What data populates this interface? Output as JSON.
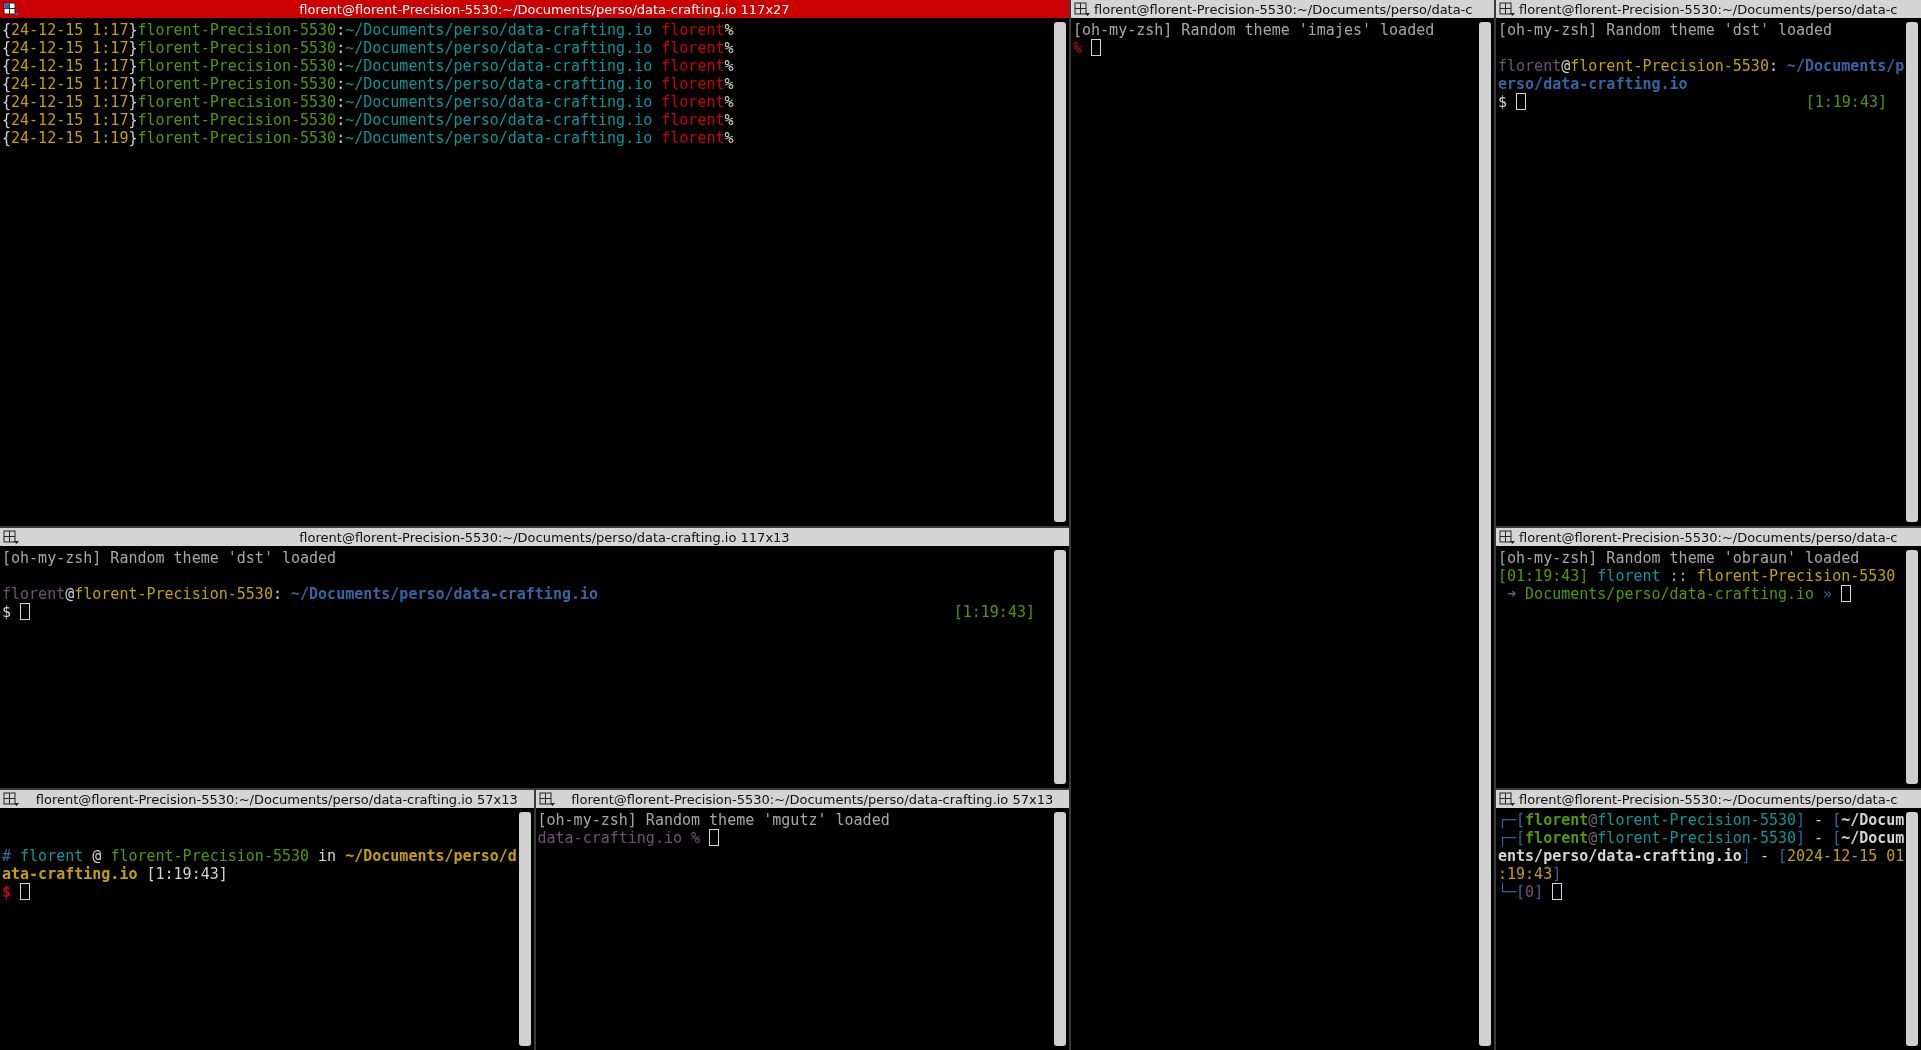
{
  "columns": [
    {
      "rows": [
        {
          "panes": [
            {
              "title": "florent@florent-Precision-5530:~/Documents/perso/data-crafting.io 117x27",
              "active": true,
              "lines": [
                {
                  "kind": "text",
                  "segments": [
                    {
                      "text": "{",
                      "color": "#d3d7cf",
                      "kind": "text"
                    },
                    {
                      "text": "24-12-15 1:17",
                      "color": "#c4a000",
                      "kind": "text"
                    },
                    {
                      "text": "}",
                      "color": "#d3d7cf",
                      "kind": "text"
                    },
                    {
                      "text": "florent-Precision-5530",
                      "color": "#4e9a06",
                      "kind": "text"
                    },
                    {
                      "text": ":",
                      "color": "#d3d7cf",
                      "kind": "text"
                    },
                    {
                      "text": "~/Documents/perso/data-crafting.io ",
                      "color": "#06989a",
                      "kind": "text"
                    },
                    {
                      "text": "florent",
                      "color": "#cc0000",
                      "kind": "text"
                    },
                    {
                      "text": "%",
                      "color": "#d3d7cf",
                      "kind": "text"
                    }
                  ]
                },
                {
                  "kind": "text",
                  "segments": [
                    {
                      "text": "{",
                      "color": "#d3d7cf",
                      "kind": "text"
                    },
                    {
                      "text": "24-12-15 1:17",
                      "color": "#c4a000",
                      "kind": "text"
                    },
                    {
                      "text": "}",
                      "color": "#d3d7cf",
                      "kind": "text"
                    },
                    {
                      "text": "florent-Precision-5530",
                      "color": "#4e9a06",
                      "kind": "text"
                    },
                    {
                      "text": ":",
                      "color": "#d3d7cf",
                      "kind": "text"
                    },
                    {
                      "text": "~/Documents/perso/data-crafting.io ",
                      "color": "#06989a",
                      "kind": "text"
                    },
                    {
                      "text": "florent",
                      "color": "#cc0000",
                      "kind": "text"
                    },
                    {
                      "text": "%",
                      "color": "#d3d7cf",
                      "kind": "text"
                    }
                  ]
                },
                {
                  "kind": "text",
                  "segments": [
                    {
                      "text": "{",
                      "color": "#d3d7cf",
                      "kind": "text"
                    },
                    {
                      "text": "24-12-15 1:17",
                      "color": "#c4a000",
                      "kind": "text"
                    },
                    {
                      "text": "}",
                      "color": "#d3d7cf",
                      "kind": "text"
                    },
                    {
                      "text": "florent-Precision-5530",
                      "color": "#4e9a06",
                      "kind": "text"
                    },
                    {
                      "text": ":",
                      "color": "#d3d7cf",
                      "kind": "text"
                    },
                    {
                      "text": "~/Documents/perso/data-crafting.io ",
                      "color": "#06989a",
                      "kind": "text"
                    },
                    {
                      "text": "florent",
                      "color": "#cc0000",
                      "kind": "text"
                    },
                    {
                      "text": "%",
                      "color": "#d3d7cf",
                      "kind": "text"
                    }
                  ]
                },
                {
                  "kind": "text",
                  "segments": [
                    {
                      "text": "{",
                      "color": "#d3d7cf",
                      "kind": "text"
                    },
                    {
                      "text": "24-12-15 1:17",
                      "color": "#c4a000",
                      "kind": "text"
                    },
                    {
                      "text": "}",
                      "color": "#d3d7cf",
                      "kind": "text"
                    },
                    {
                      "text": "florent-Precision-5530",
                      "color": "#4e9a06",
                      "kind": "text"
                    },
                    {
                      "text": ":",
                      "color": "#d3d7cf",
                      "kind": "text"
                    },
                    {
                      "text": "~/Documents/perso/data-crafting.io ",
                      "color": "#06989a",
                      "kind": "text"
                    },
                    {
                      "text": "florent",
                      "color": "#cc0000",
                      "kind": "text"
                    },
                    {
                      "text": "%",
                      "color": "#d3d7cf",
                      "kind": "text"
                    }
                  ]
                },
                {
                  "kind": "text",
                  "segments": [
                    {
                      "text": "{",
                      "color": "#d3d7cf",
                      "kind": "text"
                    },
                    {
                      "text": "24-12-15 1:17",
                      "color": "#c4a000",
                      "kind": "text"
                    },
                    {
                      "text": "}",
                      "color": "#d3d7cf",
                      "kind": "text"
                    },
                    {
                      "text": "florent-Precision-5530",
                      "color": "#4e9a06",
                      "kind": "text"
                    },
                    {
                      "text": ":",
                      "color": "#d3d7cf",
                      "kind": "text"
                    },
                    {
                      "text": "~/Documents/perso/data-crafting.io ",
                      "color": "#06989a",
                      "kind": "text"
                    },
                    {
                      "text": "florent",
                      "color": "#cc0000",
                      "kind": "text"
                    },
                    {
                      "text": "%",
                      "color": "#d3d7cf",
                      "kind": "text"
                    }
                  ]
                },
                {
                  "kind": "text",
                  "segments": [
                    {
                      "text": "{",
                      "color": "#d3d7cf",
                      "kind": "text"
                    },
                    {
                      "text": "24-12-15 1:17",
                      "color": "#c4a000",
                      "kind": "text"
                    },
                    {
                      "text": "}",
                      "color": "#d3d7cf",
                      "kind": "text"
                    },
                    {
                      "text": "florent-Precision-5530",
                      "color": "#4e9a06",
                      "kind": "text"
                    },
                    {
                      "text": ":",
                      "color": "#d3d7cf",
                      "kind": "text"
                    },
                    {
                      "text": "~/Documents/perso/data-crafting.io ",
                      "color": "#06989a",
                      "kind": "text"
                    },
                    {
                      "text": "florent",
                      "color": "#cc0000",
                      "kind": "text"
                    },
                    {
                      "text": "%",
                      "color": "#d3d7cf",
                      "kind": "text"
                    }
                  ]
                },
                {
                  "kind": "text",
                  "segments": [
                    {
                      "text": "{",
                      "color": "#d3d7cf",
                      "kind": "text"
                    },
                    {
                      "text": "24-12-15 1:19",
                      "color": "#c4a000",
                      "kind": "text"
                    },
                    {
                      "text": "}",
                      "color": "#d3d7cf",
                      "kind": "text"
                    },
                    {
                      "text": "florent-Precision-5530",
                      "color": "#4e9a06",
                      "kind": "text"
                    },
                    {
                      "text": ":",
                      "color": "#d3d7cf",
                      "kind": "text"
                    },
                    {
                      "text": "~/Documents/perso/data-crafting.io ",
                      "color": "#06989a",
                      "kind": "text"
                    },
                    {
                      "text": "florent",
                      "color": "#cc0000",
                      "kind": "text"
                    },
                    {
                      "text": "%",
                      "color": "#d3d7cf",
                      "kind": "text"
                    }
                  ]
                }
              ]
            }
          ]
        },
        {
          "panes": [
            {
              "title": "florent@florent-Precision-5530:~/Documents/perso/data-crafting.io 117x13",
              "active": false,
              "lines": [
                {
                  "kind": "text",
                  "segments": [
                    {
                      "text": "[oh-my-zsh] Random theme 'dst' loaded",
                      "color": "#a8a8a8",
                      "kind": "text"
                    }
                  ]
                },
                {
                  "kind": "blank"
                },
                {
                  "kind": "text",
                  "segments": [
                    {
                      "text": "florent",
                      "color": "#75507b",
                      "kind": "text"
                    },
                    {
                      "text": "@",
                      "color": "#d3d7cf",
                      "kind": "text"
                    },
                    {
                      "text": "florent-Precision-5530",
                      "color": "#c4a000",
                      "kind": "text"
                    },
                    {
                      "text": ": ",
                      "color": "#d3d7cf",
                      "kind": "text"
                    },
                    {
                      "text": "~/Documents/perso/data-crafting.io",
                      "color": "#3465a4",
                      "kind": "bold"
                    }
                  ]
                },
                {
                  "kind": "text",
                  "segments": [
                    {
                      "text": "$ ",
                      "color": "#d3d7cf",
                      "kind": "text"
                    },
                    {
                      "kind": "cursor"
                    }
                  ],
                  "right": {
                    "text": "[1:19:43]",
                    "color": "#4e9a06"
                  }
                }
              ]
            }
          ]
        },
        {
          "panes": [
            {
              "title": "florent@florent-Precision-5530:~/Documents/perso/data-crafting.io 57x13",
              "active": false,
              "lines": [
                {
                  "kind": "blank"
                },
                {
                  "kind": "blank"
                },
                {
                  "kind": "text",
                  "segments": [
                    {
                      "text": "# ",
                      "color": "#3465a4",
                      "kind": "text"
                    },
                    {
                      "text": "florent",
                      "color": "#06989a",
                      "kind": "text"
                    },
                    {
                      "text": " @ ",
                      "color": "#d3d7cf",
                      "kind": "text"
                    },
                    {
                      "text": "florent-Precision-5530",
                      "color": "#4e9a06",
                      "kind": "text"
                    },
                    {
                      "text": " in ",
                      "color": "#d3d7cf",
                      "kind": "text"
                    },
                    {
                      "text": "~/Documents/perso/d",
                      "color": "#c4a000",
                      "kind": "bold"
                    }
                  ]
                },
                {
                  "kind": "text",
                  "segments": [
                    {
                      "text": "ata-crafting.io",
                      "color": "#c4a000",
                      "kind": "bold"
                    },
                    {
                      "text": " [1:19:43]",
                      "color": "#d3d7cf",
                      "kind": "text"
                    }
                  ]
                },
                {
                  "kind": "text",
                  "segments": [
                    {
                      "text": "$ ",
                      "color": "#cc0000",
                      "kind": "bold"
                    },
                    {
                      "kind": "cursor"
                    }
                  ]
                }
              ]
            },
            {
              "title": "florent@florent-Precision-5530:~/Documents/perso/data-crafting.io 57x13",
              "active": false,
              "lines": [
                {
                  "kind": "text",
                  "segments": [
                    {
                      "text": "[oh-my-zsh] Random theme 'mgutz' loaded",
                      "color": "#a8a8a8",
                      "kind": "text"
                    }
                  ]
                },
                {
                  "kind": "text",
                  "segments": [
                    {
                      "text": "data-crafting.io % ",
                      "color": "#75507b",
                      "kind": "text"
                    },
                    {
                      "kind": "cursor"
                    }
                  ]
                }
              ]
            }
          ]
        }
      ]
    },
    {
      "rows": [
        {
          "panes": [
            {
              "title": "florent@florent-Precision-5530:~/Documents/perso/data-c",
              "active": false,
              "lines": [
                {
                  "kind": "text",
                  "segments": [
                    {
                      "text": "[oh-my-zsh] Random theme 'imajes' loaded",
                      "color": "#a8a8a8",
                      "kind": "text"
                    }
                  ]
                },
                {
                  "kind": "text",
                  "segments": [
                    {
                      "text": "% ",
                      "color": "#cc0000",
                      "kind": "text"
                    },
                    {
                      "kind": "cursor"
                    }
                  ]
                }
              ]
            }
          ]
        }
      ]
    },
    {
      "rows": [
        {
          "panes": [
            {
              "title": "florent@florent-Precision-5530:~/Documents/perso/data-c",
              "active": false,
              "lines": [
                {
                  "kind": "text",
                  "segments": [
                    {
                      "text": "[oh-my-zsh] Random theme 'dst' loaded",
                      "color": "#a8a8a8",
                      "kind": "text"
                    }
                  ]
                },
                {
                  "kind": "blank"
                },
                {
                  "kind": "text",
                  "segments": [
                    {
                      "text": "florent",
                      "color": "#75507b",
                      "kind": "text"
                    },
                    {
                      "text": "@",
                      "color": "#d3d7cf",
                      "kind": "text"
                    },
                    {
                      "text": "florent-Precision-5530",
                      "color": "#c4a000",
                      "kind": "text"
                    },
                    {
                      "text": ": ",
                      "color": "#d3d7cf",
                      "kind": "text"
                    },
                    {
                      "text": "~/Documents/p",
                      "color": "#3465a4",
                      "kind": "bold"
                    }
                  ]
                },
                {
                  "kind": "text",
                  "segments": [
                    {
                      "text": "erso/data-crafting.io",
                      "color": "#3465a4",
                      "kind": "bold"
                    }
                  ]
                },
                {
                  "kind": "text",
                  "segments": [
                    {
                      "text": "$ ",
                      "color": "#d3d7cf",
                      "kind": "text"
                    },
                    {
                      "kind": "cursor"
                    }
                  ],
                  "right": {
                    "text": "[1:19:43]",
                    "color": "#4e9a06"
                  }
                }
              ]
            }
          ]
        },
        {
          "panes": [
            {
              "title": "florent@florent-Precision-5530:~/Documents/perso/data-c",
              "active": false,
              "lines": [
                {
                  "kind": "text",
                  "segments": [
                    {
                      "text": "[oh-my-zsh] Random theme 'obraun' loaded",
                      "color": "#a8a8a8",
                      "kind": "text"
                    }
                  ]
                },
                {
                  "kind": "text",
                  "segments": [
                    {
                      "text": "[01:19:43] ",
                      "color": "#4e9a06",
                      "kind": "text"
                    },
                    {
                      "text": "florent",
                      "color": "#06989a",
                      "kind": "text"
                    },
                    {
                      "text": " :: ",
                      "color": "#a8a8a8",
                      "kind": "text"
                    },
                    {
                      "text": "florent-Precision-5530",
                      "color": "#c4a000",
                      "kind": "text"
                    }
                  ]
                },
                {
                  "kind": "text",
                  "segments": [
                    {
                      "text": " ➜ ",
                      "color": "#75507b",
                      "kind": "text"
                    },
                    {
                      "text": "Documents/perso/data-crafting.io",
                      "color": "#4e9a06",
                      "kind": "text"
                    },
                    {
                      "text": " » ",
                      "color": "#3465a4",
                      "kind": "text"
                    },
                    {
                      "kind": "cursor"
                    }
                  ]
                }
              ]
            }
          ]
        },
        {
          "panes": [
            {
              "title": "florent@florent-Precision-5530:~/Documents/perso/data-c",
              "active": false,
              "lines": [
                {
                  "kind": "text",
                  "segments": [
                    {
                      "text": "┌─[",
                      "color": "#3465a4",
                      "kind": "text"
                    },
                    {
                      "text": "florent",
                      "color": "#4e9a06",
                      "kind": "bold"
                    },
                    {
                      "text": "@",
                      "color": "#6a6a6a",
                      "kind": "text"
                    },
                    {
                      "text": "florent-Precision-5530",
                      "color": "#06989a",
                      "kind": "text"
                    },
                    {
                      "text": "]",
                      "color": "#3465a4",
                      "kind": "text"
                    },
                    {
                      "text": " - ",
                      "color": "#d3d7cf",
                      "kind": "text"
                    },
                    {
                      "text": "[",
                      "color": "#3465a4",
                      "kind": "text"
                    },
                    {
                      "text": "~/Docum",
                      "color": "#d3d7cf",
                      "kind": "bold"
                    }
                  ]
                },
                {
                  "kind": "text",
                  "segments": [
                    {
                      "text": "┌─[",
                      "color": "#3465a4",
                      "kind": "text"
                    },
                    {
                      "text": "florent",
                      "color": "#4e9a06",
                      "kind": "bold"
                    },
                    {
                      "text": "@",
                      "color": "#6a6a6a",
                      "kind": "text"
                    },
                    {
                      "text": "florent-Precision-5530",
                      "color": "#06989a",
                      "kind": "text"
                    },
                    {
                      "text": "]",
                      "color": "#3465a4",
                      "kind": "text"
                    },
                    {
                      "text": " - ",
                      "color": "#d3d7cf",
                      "kind": "text"
                    },
                    {
                      "text": "[",
                      "color": "#3465a4",
                      "kind": "text"
                    },
                    {
                      "text": "~/Docum",
                      "color": "#d3d7cf",
                      "kind": "bold"
                    }
                  ]
                },
                {
                  "kind": "text",
                  "segments": [
                    {
                      "text": "ents/perso/data-crafting.io",
                      "color": "#d3d7cf",
                      "kind": "bold"
                    },
                    {
                      "text": "]",
                      "color": "#3465a4",
                      "kind": "text"
                    },
                    {
                      "text": " - ",
                      "color": "#d3d7cf",
                      "kind": "text"
                    },
                    {
                      "text": "[",
                      "color": "#3465a4",
                      "kind": "text"
                    },
                    {
                      "text": "2024-12-15 01",
                      "color": "#c4a000",
                      "kind": "text"
                    }
                  ]
                },
                {
                  "kind": "text",
                  "segments": [
                    {
                      "text": ":19:43",
                      "color": "#c4a000",
                      "kind": "text"
                    },
                    {
                      "text": "]",
                      "color": "#3465a4",
                      "kind": "text"
                    }
                  ]
                },
                {
                  "kind": "text",
                  "segments": [
                    {
                      "text": "└─[",
                      "color": "#3465a4",
                      "kind": "text"
                    },
                    {
                      "text": "0",
                      "color": "#75507b",
                      "kind": "text"
                    },
                    {
                      "text": "] ",
                      "color": "#3465a4",
                      "kind": "text"
                    },
                    {
                      "kind": "cursor"
                    }
                  ]
                }
              ]
            }
          ]
        }
      ]
    }
  ]
}
